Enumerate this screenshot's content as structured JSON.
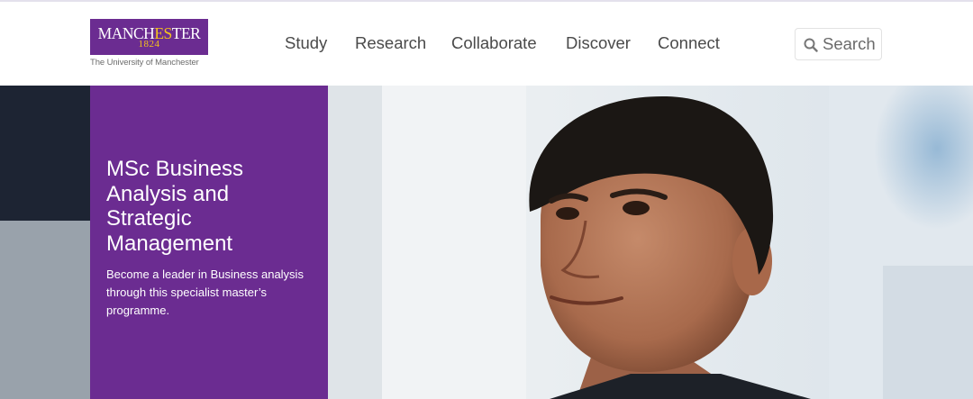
{
  "logo": {
    "word_start": "MANCH",
    "word_gold": "ES",
    "word_mid": "T",
    "word_end": "ER",
    "year": "1824",
    "subtitle": "The University of Manchester"
  },
  "nav": {
    "items": [
      {
        "label": "Study"
      },
      {
        "label": "Research"
      },
      {
        "label": "Collaborate"
      },
      {
        "label": "Discover"
      },
      {
        "label": "Connect"
      }
    ]
  },
  "search": {
    "placeholder": "Search",
    "icon": "search-icon"
  },
  "hero": {
    "title": "MSc Business Analysis and Strategic Management",
    "description": "Become a leader in Business analysis through this specialist master’s programme."
  },
  "colors": {
    "brand_purple": "#6b2c91",
    "brand_gold": "#f3c31c",
    "nav_text": "#4a4a4a"
  }
}
